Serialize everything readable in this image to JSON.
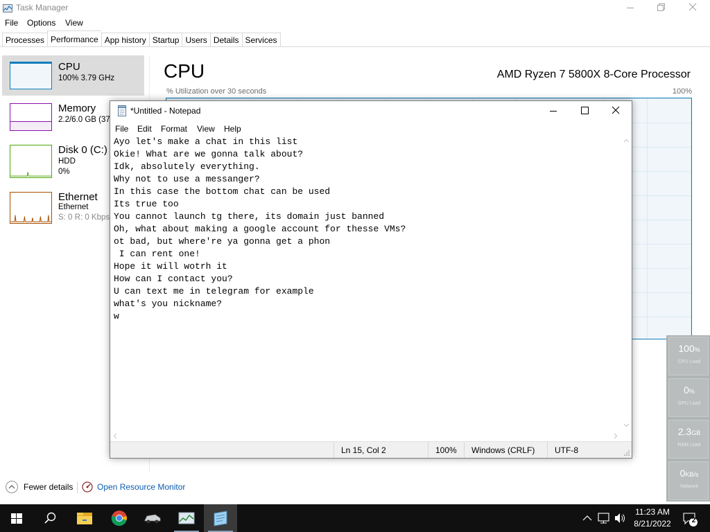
{
  "task_manager": {
    "title": "Task Manager",
    "menu": [
      "File",
      "Options",
      "View"
    ],
    "tabs": [
      "Processes",
      "Performance",
      "App history",
      "Startup",
      "Users",
      "Details",
      "Services"
    ],
    "active_tab": "Performance",
    "sidebar": {
      "cpu": {
        "name": "CPU",
        "sub": "100% 3.79 GHz"
      },
      "memory": {
        "name": "Memory",
        "sub": "2.2/6.0 GB (37"
      },
      "disk": {
        "name": "Disk 0 (C:)",
        "sub1": "HDD",
        "sub2": "0%"
      },
      "ethernet": {
        "name": "Ethernet",
        "sub1": "Ethernet",
        "sub2": "S: 0 R: 0 Kbps"
      }
    },
    "main": {
      "title": "CPU",
      "processor": "AMD Ryzen 7 5800X 8-Core Processor",
      "util_label": "% Utilization over 30 seconds",
      "max_label": "100%"
    },
    "footer": {
      "fewer_details": "Fewer details",
      "open_resource_monitor": "Open Resource Monitor"
    },
    "colors": {
      "cpu": "#117dbb",
      "memory": "#8b12ae",
      "disk": "#4da60c",
      "ethernet": "#a74f01",
      "link": "#0b5cad"
    }
  },
  "widget": {
    "cpu": {
      "value": "100",
      "unit": "%",
      "label": "CPU Load"
    },
    "gpu": {
      "value": "0",
      "unit": "%",
      "label": "GPU Load"
    },
    "ram": {
      "value": "2.3",
      "unit": "GB",
      "label": "RAM Load"
    },
    "net": {
      "value": "0",
      "unit": "KB/s",
      "label": "Network"
    }
  },
  "notepad": {
    "title": "*Untitled - Notepad",
    "menu": [
      "File",
      "Edit",
      "Format",
      "View",
      "Help"
    ],
    "lines": [
      "Ayo let's make a chat in this list",
      "Okie! What are we gonna talk about?",
      "Idk, absolutely everything.",
      "Why not to use a messanger?",
      "In this case the bottom chat can be used",
      "Its true too",
      "You cannot launch tg there, its domain just banned",
      "Oh, what about making a google account for thesse VMs?",
      "ot bad, but where're ya gonna get a phon",
      " I can rent one!",
      "Hope it will wotrh it",
      "How can I contact you?",
      "U can text me in telegram for example",
      "what's you nickname?",
      "w"
    ],
    "status": {
      "position": "Ln 15, Col 2",
      "zoom": "100%",
      "line_ending": "Windows (CRLF)",
      "encoding": "UTF-8"
    }
  },
  "taskbar": {
    "time": "11:23 AM",
    "date": "8/21/2022",
    "notification_count": "2",
    "icons": [
      "windows-start-icon",
      "search-icon",
      "file-explorer-icon",
      "chrome-icon",
      "car-app-icon",
      "task-manager-icon",
      "notepad-icon"
    ]
  }
}
